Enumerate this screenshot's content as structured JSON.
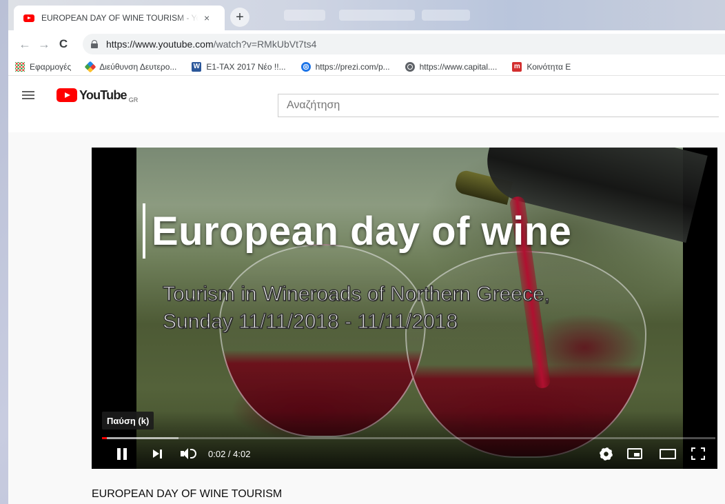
{
  "tab": {
    "title": "EUROPEAN DAY OF WINE TOURISM - YouTube",
    "close": "×",
    "new_tab": "+"
  },
  "toolbar": {
    "back": "←",
    "forward": "→",
    "reload": "C",
    "url_host": "https://www.youtube.com",
    "url_path": "/watch?v=RMkUbVt7ts4"
  },
  "bookmarks": [
    {
      "icon": "apps-icon",
      "label": "Εφαρμογές"
    },
    {
      "icon": "ddp-icon",
      "label": "Διεύθυνση Δευτερο..."
    },
    {
      "icon": "w-icon",
      "label": "E1-TAX 2017 Νέο !!..."
    },
    {
      "icon": "prezi-icon",
      "label": "https://prezi.com/p..."
    },
    {
      "icon": "globe-icon",
      "label": "https://www.capital...."
    },
    {
      "icon": "m-icon",
      "label": "Κοινότητα Ε"
    }
  ],
  "bookmark_glyphs": {
    "w": "W",
    "m": "m"
  },
  "masthead": {
    "logo_text": "YouTube",
    "country": "GR",
    "search_placeholder": "Αναζήτηση"
  },
  "player": {
    "overlay_title": "European day of wine",
    "overlay_sub_1": "Tourism in Wineroads of Northern Greece,",
    "overlay_sub_2": "Sunday 11/11/2018 - 11/11/2018",
    "tooltip": "Παύση (k)",
    "time": "0:02 / 4:02",
    "played_fraction": 0.008,
    "buffered_fraction": 0.125
  },
  "video": {
    "title": "EUROPEAN DAY OF WINE TOURISM"
  },
  "colors": {
    "brand_red": "#ff0000",
    "tab_strip": "#dee1e6"
  }
}
